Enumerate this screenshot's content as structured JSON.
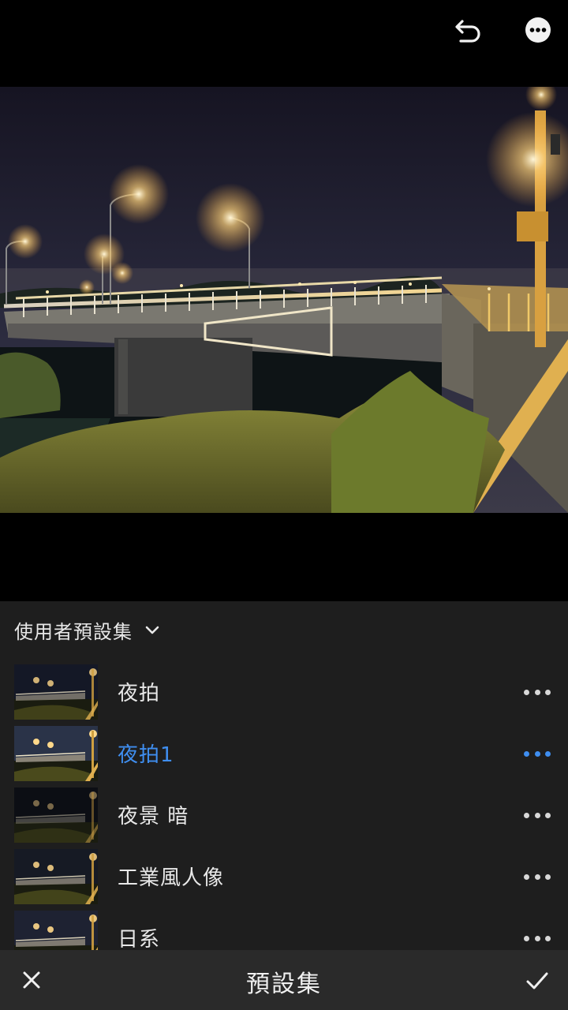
{
  "header": {
    "undo_icon": "undo-icon",
    "more_icon": "more-options-icon"
  },
  "photo": {
    "subject": "night bridge",
    "icon": "photo-preview"
  },
  "panel": {
    "group_title": "使用者預設集",
    "group_icon": "chevron-down-icon",
    "presets": [
      {
        "label": "夜拍",
        "active": false
      },
      {
        "label": "夜拍1",
        "active": true
      },
      {
        "label": "夜景 暗",
        "active": false
      },
      {
        "label": "工業風人像",
        "active": false
      },
      {
        "label": "日系",
        "active": false
      }
    ],
    "accent_color": "#3f8ef0"
  },
  "footer": {
    "title": "預設集",
    "close_icon": "close-icon",
    "confirm_icon": "checkmark-icon"
  }
}
